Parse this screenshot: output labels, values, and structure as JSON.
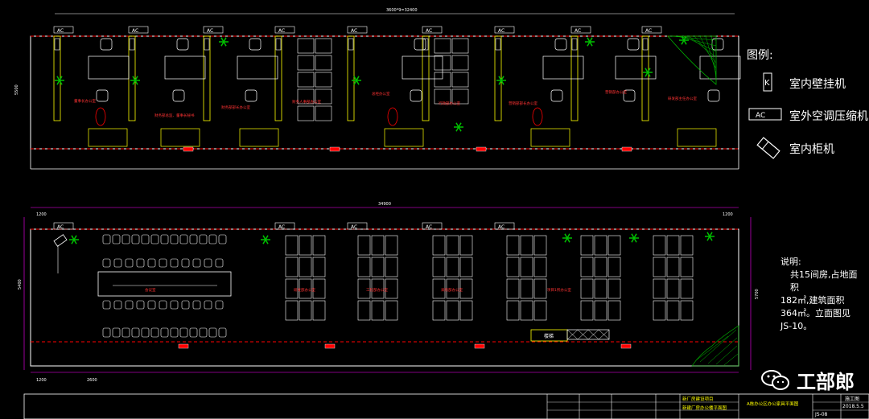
{
  "top_plan": {
    "overall_dim": "3600*9=32400",
    "side_dim": "5500",
    "ac_tag": "AC",
    "room_labels": [
      "董事长办公室",
      "财务部总监、董事长秘书",
      "财务部部长办公室",
      "财务人事部办公室",
      "总经办公室",
      "行政部办公室",
      "营销部部长办公室",
      "营销部办公室",
      "研发部主任办公室"
    ]
  },
  "bottom_plan": {
    "overall_dim": "34900",
    "left_dims": [
      "1200",
      "2600"
    ],
    "right_dim": "1200",
    "side_dims": [
      "5400",
      "5700"
    ],
    "room_labels": [
      "会议室",
      "研发部办公室",
      "工程部办公室",
      "采购部办公室",
      "项目1所办公室"
    ],
    "stair_label": "楼梯"
  },
  "legend": {
    "title": "图例:",
    "items": [
      {
        "icon": "wall-unit-icon",
        "symbol": "K",
        "label": "室内壁挂机"
      },
      {
        "icon": "outdoor-compressor-icon",
        "symbol": "AC",
        "label": "室外空调压缩机"
      },
      {
        "icon": "cabinet-unit-icon",
        "symbol": "",
        "label": "室内柜机"
      }
    ]
  },
  "notes": {
    "heading": "说明:",
    "lines": [
      "共15间房,占地面积",
      "182㎡,建筑面积",
      "364㎡。立面图见",
      "JS-10。"
    ]
  },
  "title_block": {
    "project_a": "新厂房建设项目",
    "project_b": "新建厂房办公楼平面图",
    "drawing_title": "A栋办公区办公家具平面图",
    "stage": "施工图",
    "date": "2018.5.5",
    "sheet": "JS-08"
  },
  "watermark": {
    "text": "工部郎"
  },
  "colors": {
    "line_white": "#ffffff",
    "line_red": "#ff0000",
    "line_yellow": "#ffff00",
    "line_green": "#00c000",
    "line_cyan": "#00ffff",
    "dim_magenta": "#ff00ff"
  }
}
